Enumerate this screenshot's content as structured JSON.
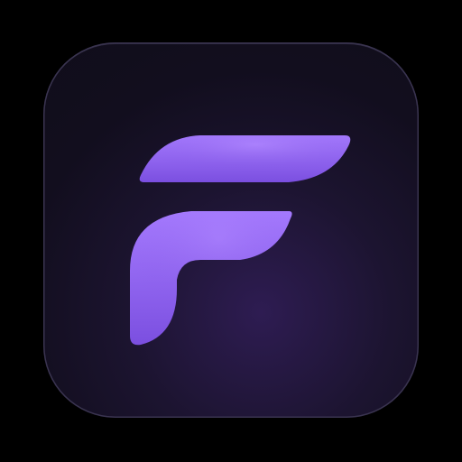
{
  "icon": {
    "name": "purple-f-logo",
    "tile_color": "#120e1e",
    "glow_color": "#2e1c52",
    "border_color": "#3a3450",
    "logo_color_light": "#a67bff",
    "logo_color_dark": "#7b4fe0"
  }
}
